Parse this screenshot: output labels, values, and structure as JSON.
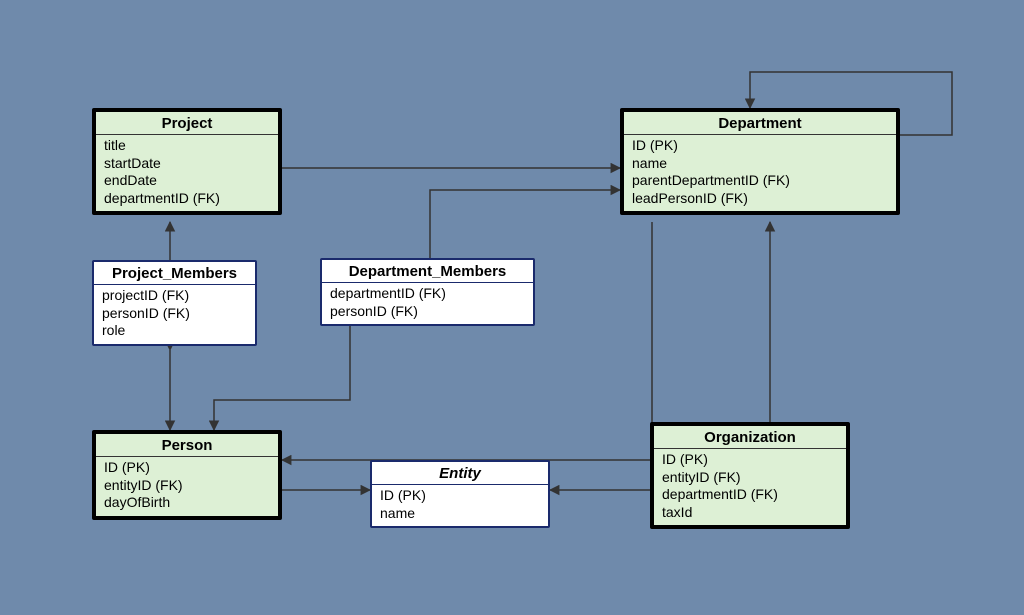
{
  "entities": {
    "project": {
      "title": "Project",
      "attrs": [
        "title",
        "startDate",
        "endDate",
        "departmentID (FK)"
      ]
    },
    "department": {
      "title": "Department",
      "attrs": [
        "ID (PK)",
        "name",
        "parentDepartmentID (FK)",
        "leadPersonID (FK)"
      ]
    },
    "project_members": {
      "title": "Project_Members",
      "attrs": [
        "projectID (FK)",
        "personID (FK)",
        "role"
      ]
    },
    "department_members": {
      "title": "Department_Members",
      "attrs": [
        "departmentID (FK)",
        "personID (FK)"
      ]
    },
    "person": {
      "title": "Person",
      "attrs": [
        "ID (PK)",
        "entityID (FK)",
        "dayOfBirth"
      ]
    },
    "organization": {
      "title": "Organization",
      "attrs": [
        "ID (PK)",
        "entityID (FK)",
        "departmentID (FK)",
        "taxId"
      ]
    },
    "entity": {
      "title": "Entity",
      "attrs": [
        "ID (PK)",
        "name"
      ]
    }
  },
  "relationships": [
    {
      "from": "Project.departmentID",
      "to": "Department.ID"
    },
    {
      "from": "Department.parentDepartmentID",
      "to": "Department.ID",
      "self": true
    },
    {
      "from": "Project_Members.projectID",
      "to": "Project"
    },
    {
      "from": "Project_Members.personID",
      "to": "Person"
    },
    {
      "from": "Department_Members.departmentID",
      "to": "Department"
    },
    {
      "from": "Department_Members.personID",
      "to": "Person"
    },
    {
      "from": "Department.leadPersonID",
      "to": "Person"
    },
    {
      "from": "Person.entityID",
      "to": "Entity"
    },
    {
      "from": "Organization.entityID",
      "to": "Entity"
    },
    {
      "from": "Organization.departmentID",
      "to": "Department"
    }
  ]
}
